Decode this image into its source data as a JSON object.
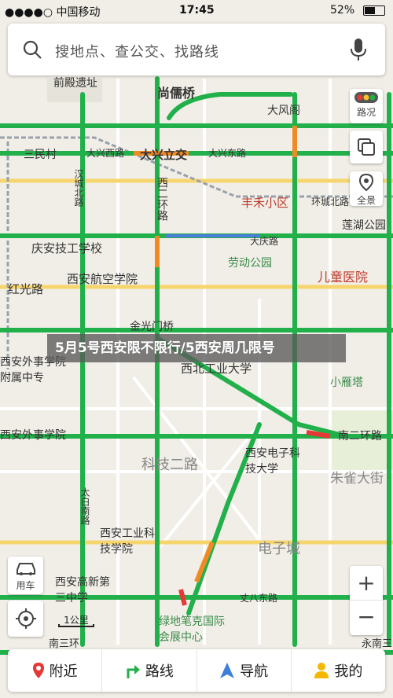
{
  "status_bar": {
    "carrier": "●●●●○ 中国移动",
    "time": "17:45",
    "battery": "52%"
  },
  "search": {
    "placeholder": "搜地点、查公交、找路线"
  },
  "controls": {
    "traffic_label": "路况",
    "panorama_label": "全景",
    "car_label": "用车",
    "zoom_in": "+",
    "zoom_out": "−",
    "scale_label": "1公里"
  },
  "banner": {
    "text": "5月5号西安限不限行/5西安周几限号"
  },
  "map_labels": {
    "l1": "前殿遗址",
    "l2": "尚儒桥",
    "l3": "大风阁",
    "l4": "三民村",
    "l5": "大兴西路",
    "l6": "大兴立交",
    "l7": "大兴东路",
    "l8": "汉城北路",
    "l9": "西二环路",
    "l10": "丰禾小区",
    "l11": "环城北路",
    "l12": "莲湖公园",
    "l13": "庆安技工学校",
    "l14": "劳动公园",
    "l15": "大庆路",
    "l16": "西安航空学院",
    "l17": "儿童医院",
    "l18": "红光路",
    "l19": "金光门桥",
    "l20": "西安外事学院附属中专",
    "l21": "西北工业大学",
    "l22": "小雁塔",
    "l23": "西安外事学院",
    "l24": "西安电子科技大学",
    "l25": "南二环路",
    "l26": "科技二路",
    "l27": "朱雀大街",
    "l28": "西安工业科技学院",
    "l29": "电子城",
    "l30": "西安高新第三中学",
    "l31": "太白南路",
    "l32": "丈八东路",
    "l33": "绿地笔克国际会展中心",
    "l34": "南三环",
    "l35": "永南三"
  },
  "bottom_nav": {
    "nearby": "附近",
    "route": "路线",
    "navigate": "导航",
    "mine": "我的"
  }
}
